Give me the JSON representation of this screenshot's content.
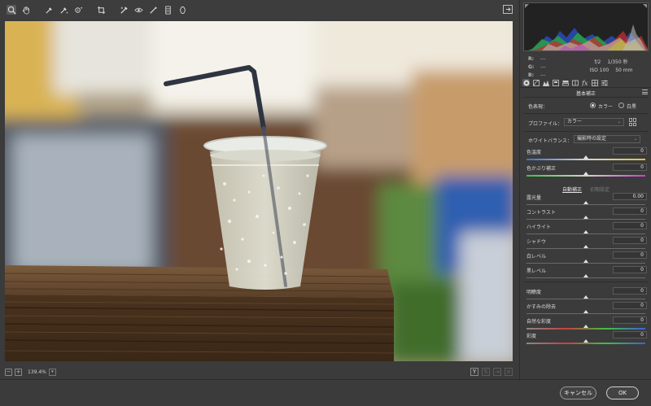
{
  "toolbar": {
    "tools": [
      "zoom-tool-icon",
      "hand-tool-icon",
      "white-balance-tool-icon",
      "color-sampler-tool-icon",
      "targeted-adjustment-tool-icon",
      "crop-tool-icon",
      "spot-removal-tool-icon",
      "red-eye-tool-icon",
      "adjustment-brush-icon",
      "graduated-filter-icon",
      "radial-filter-icon"
    ],
    "fullscreen_icon": "fullscreen-toggle-icon"
  },
  "preview_bar": {
    "zoom_out": "−",
    "zoom_in": "+",
    "zoom_value": "139.4%",
    "zoom_arrow": "▾",
    "view_y": "Y"
  },
  "readout": {
    "r_label": "R:",
    "r_value": "---",
    "g_label": "G:",
    "g_value": "---",
    "b_label": "B:",
    "b_value": "---"
  },
  "exif": {
    "aperture": "f/2",
    "shutter": "1/350 秒",
    "iso": "ISO 100",
    "focal": "50 mm"
  },
  "panel": {
    "section_title": "基本補正",
    "treatment_label": "色表現：",
    "treatment_color": "カラー",
    "treatment_bw": "白黒",
    "profile_label": "プロファイル：",
    "profile_value": "カラー",
    "wb_label": "ホワイトバランス：",
    "wb_value": "撮影時の設定",
    "auto": "自動補正",
    "default": "初期設定"
  },
  "sliders_wb": [
    {
      "name": "色温度",
      "value": "0",
      "pos": 0.5
    },
    {
      "name": "色かぶり補正",
      "value": "0",
      "pos": 0.5
    }
  ],
  "sliders_tone": [
    {
      "name": "露光量",
      "value": "0.00",
      "pos": 0.5
    },
    {
      "name": "コントラスト",
      "value": "0",
      "pos": 0.5
    },
    {
      "name": "ハイライト",
      "value": "0",
      "pos": 0.5
    },
    {
      "name": "シャドウ",
      "value": "0",
      "pos": 0.5
    },
    {
      "name": "白レベル",
      "value": "0",
      "pos": 0.5
    },
    {
      "name": "黒レベル",
      "value": "0",
      "pos": 0.5
    }
  ],
  "sliders_presence": [
    {
      "name": "明瞭度",
      "value": "0",
      "pos": 0.5
    },
    {
      "name": "かすみの除去",
      "value": "0",
      "pos": 0.5
    },
    {
      "name": "自然な彩度",
      "value": "0",
      "pos": 0.5
    },
    {
      "name": "彩度",
      "value": "0",
      "pos": 0.5
    }
  ],
  "footer": {
    "cancel": "キャンセル",
    "ok": "OK"
  }
}
